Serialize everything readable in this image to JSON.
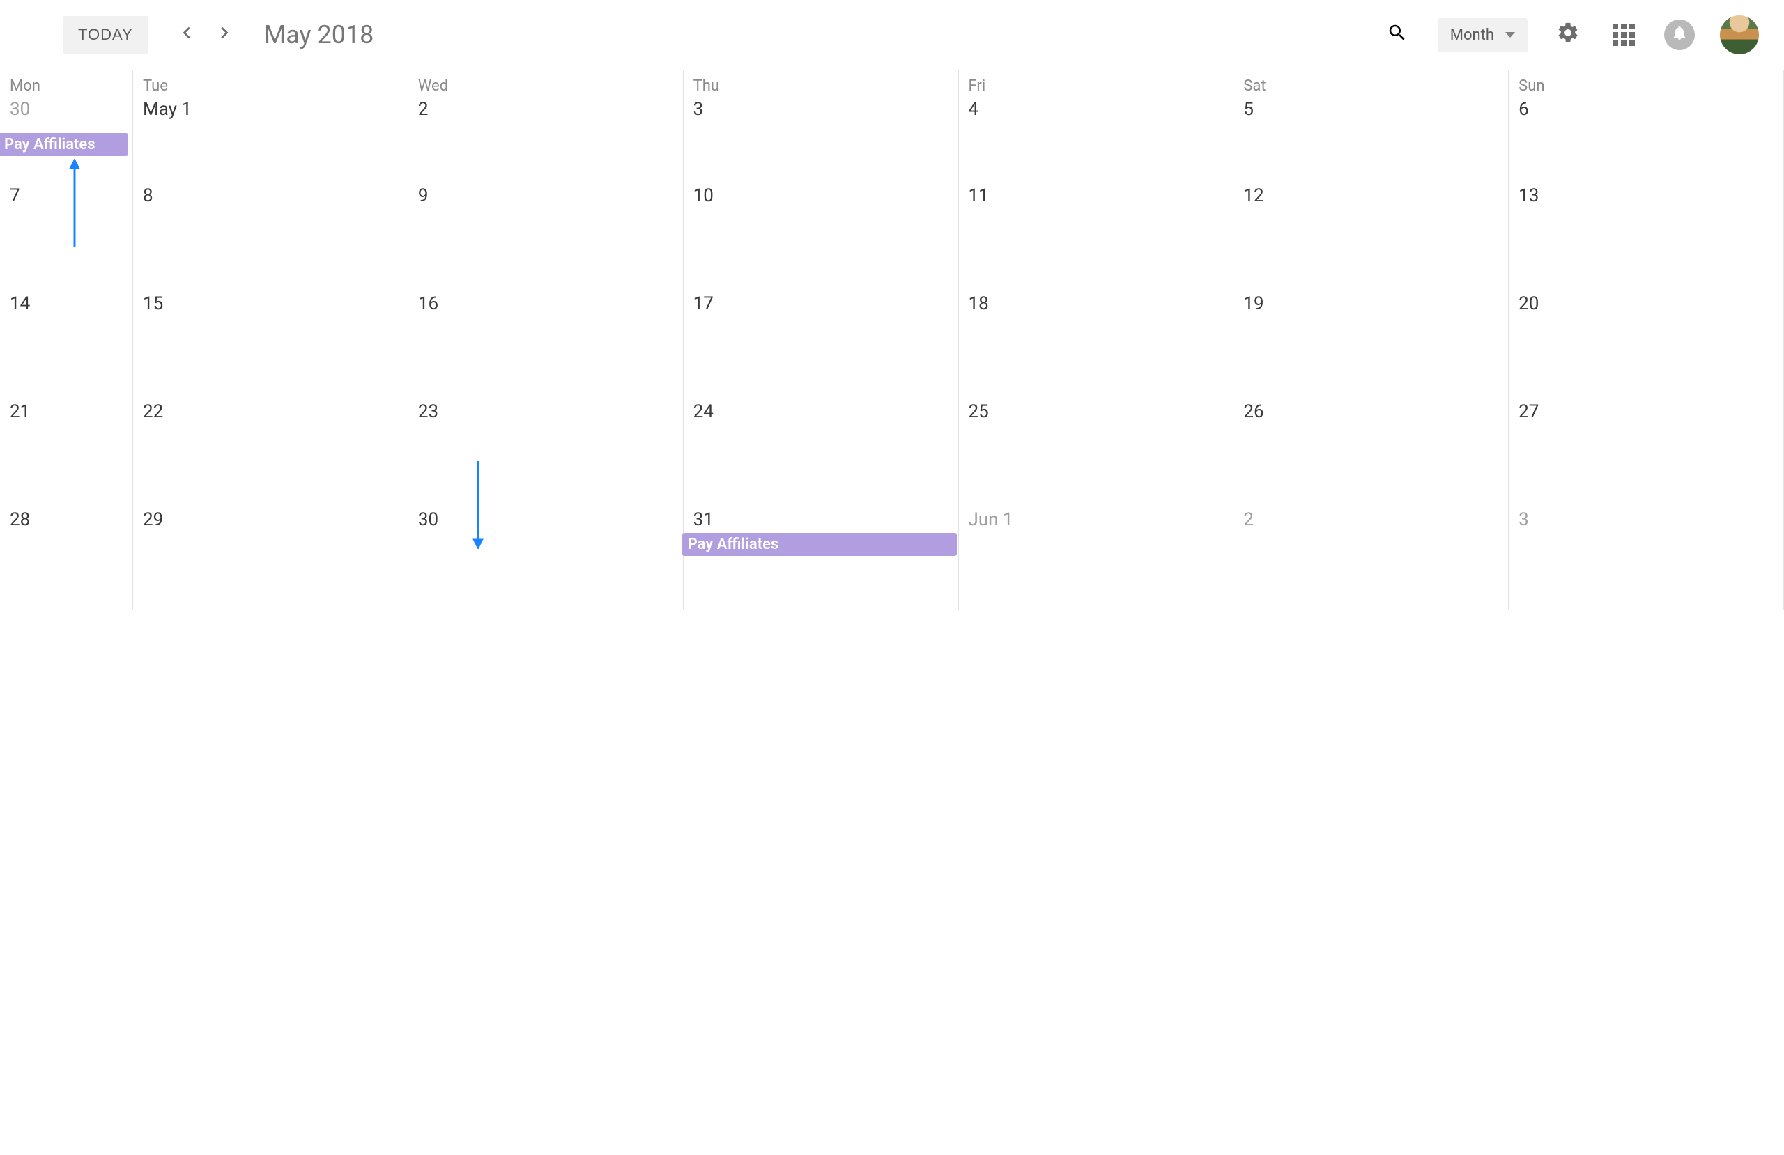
{
  "header": {
    "today_label": "TODAY",
    "month_title": "May 2018",
    "view_label": "Month"
  },
  "days_of_week": [
    "Mon",
    "Tue",
    "Wed",
    "Thu",
    "Fri",
    "Sat",
    "Sun"
  ],
  "weeks": [
    [
      "30",
      "May 1",
      "2",
      "3",
      "4",
      "5",
      "6"
    ],
    [
      "7",
      "8",
      "9",
      "10",
      "11",
      "12",
      "13"
    ],
    [
      "14",
      "15",
      "16",
      "17",
      "18",
      "19",
      "20"
    ],
    [
      "21",
      "22",
      "23",
      "24",
      "25",
      "26",
      "27"
    ],
    [
      "28",
      "29",
      "30",
      "31",
      "Jun 1",
      "2",
      "3"
    ]
  ],
  "faded": {
    "0": [
      0
    ],
    "4": [
      4,
      5,
      6
    ]
  },
  "events": {
    "0_0": "Pay Affiliates",
    "4_3": "Pay Affiliates"
  }
}
